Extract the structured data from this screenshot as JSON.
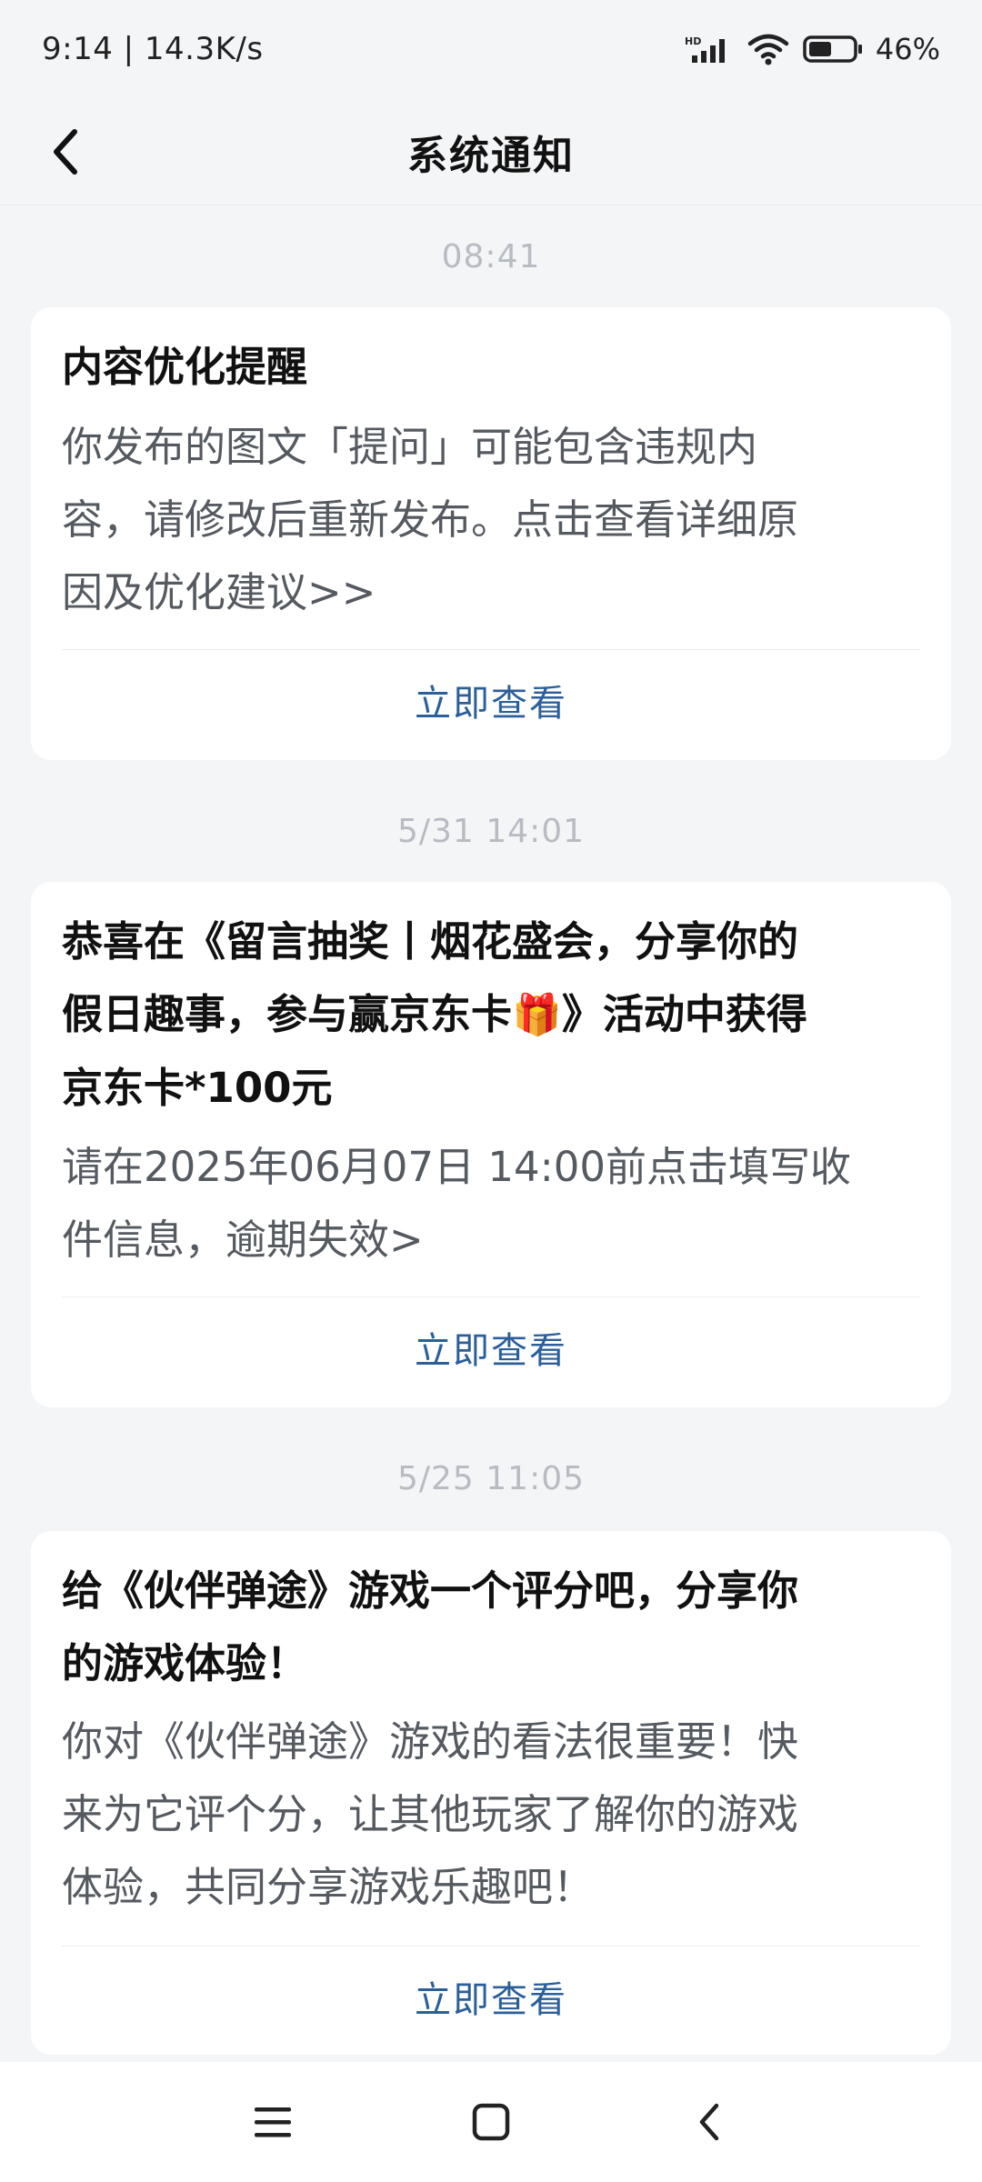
{
  "status_bar": {
    "time_speed": "9:14 | 14.3K/s",
    "battery": "46%",
    "icons": [
      "hd-signal-icon",
      "wifi-icon",
      "battery-icon"
    ]
  },
  "header": {
    "title": "系统通知",
    "back_icon": "back-arrow-icon"
  },
  "messages": [
    {
      "time": "08:41",
      "title": "内容优化提醒",
      "body_lines": [
        "你发布的图文「提问」可能包含违规内",
        "容，请修改后重新发布。点击查看详细原",
        "因及优化建议>>"
      ],
      "action": "立即查看"
    },
    {
      "time": "5/31  14:01",
      "title_lines": [
        "恭喜在《留言抽奖丨烟花盛会，分享你的",
        "假日趣事，参与赢京东卡",
        "》活动中获得",
        "京东卡*100元"
      ],
      "title_icon": "gift-icon",
      "body_lines": [
        "请在2025年06月07日 14:00前点击填写收",
        "件信息，逾期失效>"
      ],
      "action": "立即查看"
    },
    {
      "time": "5/25  11:05",
      "title_lines": [
        "给《伙伴弹途》游戏一个评分吧，分享你",
        "的游戏体验！"
      ],
      "body_lines": [
        "你对《伙伴弹途》游戏的看法很重要！快",
        "来为它评个分，让其他玩家了解你的游戏",
        "体验，共同分享游戏乐趣吧！"
      ],
      "action": "立即查看"
    }
  ],
  "nav_bar": {
    "icons": [
      "menu-icon",
      "home-icon",
      "back-icon"
    ]
  },
  "colors": {
    "background": "#f4f5f7",
    "card": "#ffffff",
    "link": "#2b5f9a",
    "timestamp": "#b8bcc2"
  }
}
